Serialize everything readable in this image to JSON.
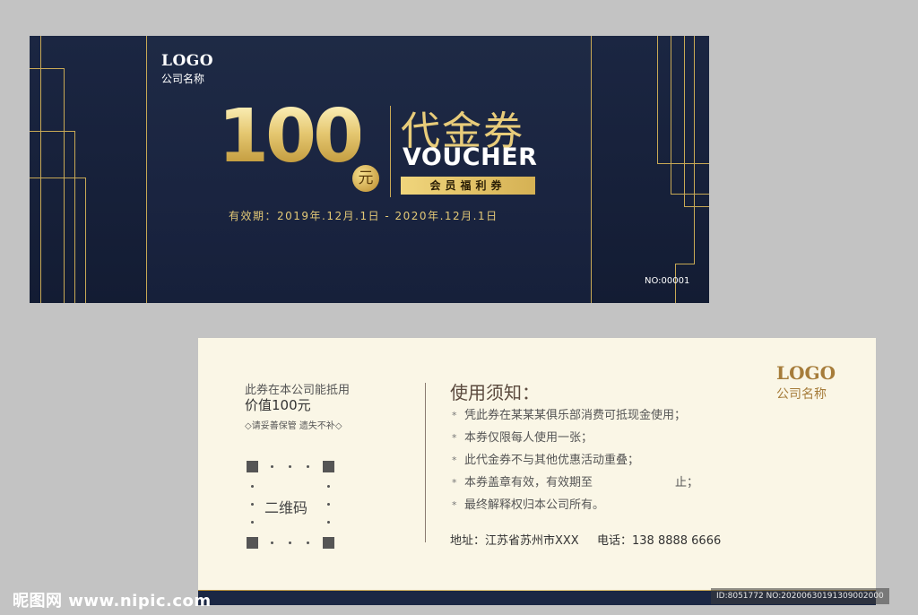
{
  "front": {
    "logo": "LOGO",
    "company": "公司名称",
    "amount": "100",
    "currency": "元",
    "title_cn": "代金券",
    "title_en": "VOUCHER",
    "member_tag": "会员福利券",
    "validity": "有效期：2019年.12月.1日 - 2020年.12月.1日",
    "voucher_no": "NO:00001"
  },
  "back": {
    "deduct_line1": "此券在本公司能抵用",
    "deduct_line2": "价值100元",
    "keep_note": "◇请妥善保管 遗失不补◇",
    "qr_label": "二维码",
    "notice_title": "使用须知：",
    "notice_items": [
      "凭此券在某某某俱乐部消费可抵现金使用；",
      "本券仅限每人使用一张；",
      "此代金券不与其他优惠活动重叠；",
      "本券盖章有效，有效期至",
      "最终解释权归本公司所有。"
    ],
    "notice_item4_suffix": "止；",
    "bullet": "*",
    "address": "地址：江苏省苏州市XXX",
    "phone": "电话：138 8888 6666",
    "logo": "LOGO",
    "company": "公司名称"
  },
  "watermark": {
    "left": "昵图网 www.nipic.com",
    "right": "ID:8051772 NO:20200630191309002000"
  },
  "colors": {
    "navy": "#1b2744",
    "gold": "#c8a955",
    "cream": "#faf6e6",
    "brown_logo": "#a67c3a"
  }
}
